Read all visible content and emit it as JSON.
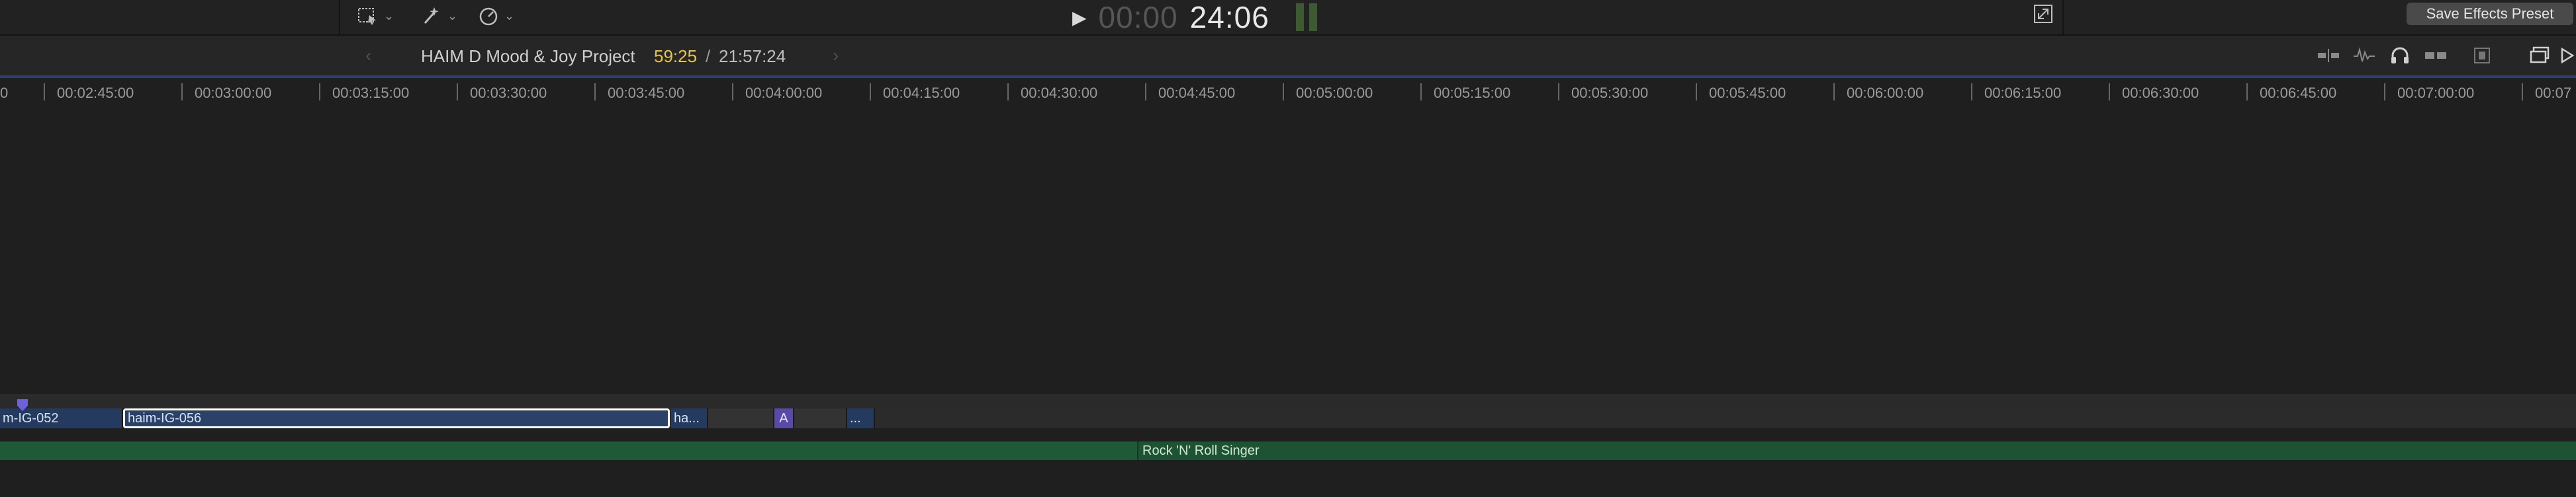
{
  "toolbar": {
    "select_tool_icon": "select-arrow-icon",
    "trim_tool_icon": "magic-wand-icon",
    "speed_icon": "speedometer-icon",
    "play_icon": "play-icon",
    "timecode_dim": "00:00",
    "timecode_bright": "24:06",
    "fullscreen_icon": "expand-icon",
    "save_preset_label": "Save Effects Preset"
  },
  "timeline_header": {
    "project_name": "HAIM D Mood & Joy Project",
    "position": "59:25",
    "separator": "/",
    "duration": "21:57:24",
    "nav_back_glyph": "‹",
    "nav_fwd_glyph": "›"
  },
  "ruler": {
    "first_label": "0",
    "labels": [
      "00:02:45:00",
      "00:03:00:00",
      "00:03:15:00",
      "00:03:30:00",
      "00:03:45:00",
      "00:04:00:00",
      "00:04:15:00",
      "00:04:30:00",
      "00:04:45:00",
      "00:05:00:00",
      "00:05:15:00",
      "00:05:30:00",
      "00:05:45:00",
      "00:06:00:00",
      "00:06:15:00",
      "00:06:30:00",
      "00:06:45:00",
      "00:07:00:00",
      "00:07"
    ]
  },
  "clips": {
    "clip1": "m-IG-052",
    "clip2": "haim-IG-056",
    "clip3": "ha...",
    "title_clip": "A",
    "clip5": "..."
  },
  "audio": {
    "clip_label": "Rock 'N' Roll Singer"
  },
  "colors": {
    "accent_timecode": "#e6c64a",
    "clip_blue": "#243a5e",
    "audio_green": "#1d5233",
    "title_purple": "#5a4aa8"
  }
}
